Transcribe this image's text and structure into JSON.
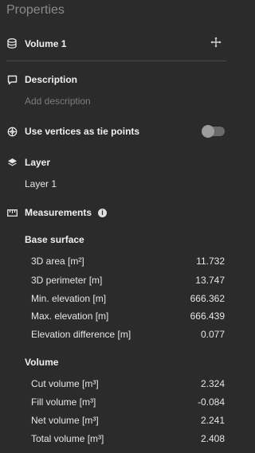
{
  "header": {
    "title": "Properties"
  },
  "volume": {
    "name": "Volume 1"
  },
  "description": {
    "label": "Description",
    "placeholder": "Add description"
  },
  "tie_points": {
    "label": "Use vertices as tie points",
    "enabled": false
  },
  "layer": {
    "label": "Layer",
    "value": "Layer 1"
  },
  "measurements": {
    "label": "Measurements",
    "base_surface": {
      "heading": "Base surface",
      "rows": [
        {
          "label": "3D area [m²]",
          "value": "11.732"
        },
        {
          "label": "3D perimeter [m]",
          "value": "13.747"
        },
        {
          "label": "Min. elevation [m]",
          "value": "666.362"
        },
        {
          "label": "Max. elevation [m]",
          "value": "666.439"
        },
        {
          "label": "Elevation difference [m]",
          "value": "0.077"
        }
      ]
    },
    "volume": {
      "heading": "Volume",
      "rows": [
        {
          "label": "Cut volume [m³]",
          "value": "2.324"
        },
        {
          "label": "Fill volume [m³]",
          "value": "-0.084"
        },
        {
          "label": "Net volume [m³]",
          "value": "2.241"
        },
        {
          "label": "Total volume [m³]",
          "value": "2.408"
        }
      ]
    }
  },
  "icons": {
    "volume": "database-icon",
    "move": "move-arrows-icon",
    "description": "comment-icon",
    "tie_points": "target-globe-icon",
    "layer": "layers-icon",
    "measurements": "ruler-icon",
    "info": "info-icon"
  },
  "colors": {
    "background": "#2b2b2b",
    "text": "#e6e6e6",
    "muted": "#7d7d7d",
    "divider": "#4a4a4a"
  }
}
